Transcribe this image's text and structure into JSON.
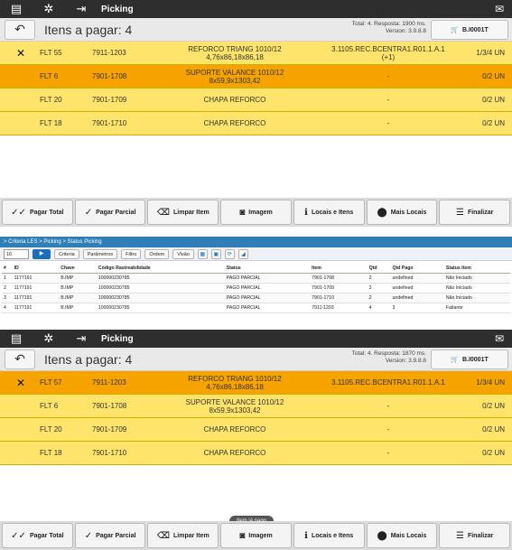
{
  "screens": [
    {
      "appbar": {
        "title": "Picking"
      },
      "header": {
        "itens_label": "Itens a pagar: 4",
        "total_line1": "Total: 4. Resposta: 1900 ms.",
        "total_line2": "Version: 3.9.8.8",
        "cart_label": "B.I0001T"
      },
      "rows": [
        {
          "flt": "FLT 55",
          "code": "7911-1203",
          "desc1": "REFORCO TRIANG 1010/12",
          "desc2": "4,76x86,18x86,18",
          "loc1": "3.1105.REC.BCENTRA1.R01.1.A.1",
          "loc2": "(+1)",
          "qty": "1/3/4 UN",
          "x": "✕"
        },
        {
          "flt": "FLT 6",
          "code": "7901-1708",
          "desc1": "SUPORTE VALANCE 1010/12",
          "desc2": "8x59,9x1303,42",
          "loc1": "-",
          "loc2": "",
          "qty": "0/2 UN"
        },
        {
          "flt": "FLT 20",
          "code": "7901-1709",
          "desc1": "CHAPA REFORCO",
          "desc2": "",
          "loc1": "-",
          "loc2": "",
          "qty": "0/2 UN"
        },
        {
          "flt": "FLT 18",
          "code": "7901-1710",
          "desc1": "CHAPA REFORCO",
          "desc2": "",
          "loc1": "-",
          "loc2": "",
          "qty": "0/2 UN"
        }
      ]
    },
    {
      "appbar": {
        "title": "Picking"
      },
      "header": {
        "itens_label": "Itens a pagar: 4",
        "total_line1": "Total: 4. Resposta: 1870 ms.",
        "total_line2": "Version: 3.9.8.8",
        "cart_label": "B.I0001T"
      },
      "rows": [
        {
          "flt": "FLT 57",
          "code": "7911-1203",
          "desc1": "REFORCO TRIANG 1010/12",
          "desc2": "4,76x86,18x86,18",
          "loc1": "3.1105.REC.BCENTRA1.R01.1.A.1",
          "loc2": "",
          "qty": "1/3/4 UN",
          "x": "✕"
        },
        {
          "flt": "FLT 6",
          "code": "7901-1708",
          "desc1": "SUPORTE VALANCE 1010/12",
          "desc2": "8x59,9x1303,42",
          "loc1": "-",
          "loc2": "",
          "qty": "0/2 UN"
        },
        {
          "flt": "FLT 20",
          "code": "7901-1709",
          "desc1": "CHAPA REFORCO",
          "desc2": "",
          "loc1": "-",
          "loc2": "",
          "qty": "0/2 UN"
        },
        {
          "flt": "FLT 18",
          "code": "7901-1710",
          "desc1": "CHAPA REFORCO",
          "desc2": "",
          "loc1": "-",
          "loc2": "",
          "qty": "0/2 UN"
        }
      ],
      "tooltip": "Item já pago"
    }
  ],
  "toolbar": {
    "pagar_total": "Pagar Total",
    "pagar_parcial": "Pagar Parcial",
    "limpar_item": "Limpar Item",
    "imagem": "Imagem",
    "locais_e_itens": "Locais e Itens",
    "mais_locais": "Mais Locais",
    "finalizar": "Finalizar"
  },
  "web": {
    "breadcrumb": "> Criteria LES > Picking > Status Picking",
    "page_size": "16",
    "buttons": {
      "criteria": "Criteria",
      "parametros": "Parâmetros",
      "filtro": "Filtro",
      "ordem": "Ordem",
      "visao": "Visão"
    },
    "columns": [
      "#",
      "ID",
      "Chave",
      "Código Rastreabilidade",
      "Status",
      "Item",
      "Qtd",
      "Qtd Pago",
      "Status Item"
    ],
    "rows": [
      [
        "1",
        "1177191",
        "B.IMP",
        "100000230785",
        "PAGO PARCIAL",
        "7901-1708",
        "2",
        "undefined",
        "Não Iniciado"
      ],
      [
        "2",
        "1177191",
        "B.IMP",
        "100000230785",
        "PAGO PARCIAL",
        "7901-1709",
        "2",
        "undefined",
        "Não Iniciado"
      ],
      [
        "3",
        "1177191",
        "B.IMP",
        "100000230785",
        "PAGO PARCIAL",
        "7901-1710",
        "2",
        "undefined",
        "Não Iniciado"
      ],
      [
        "4",
        "1177191",
        "B.IMP",
        "100000230785",
        "PAGO PARCIAL",
        "7911-1203",
        "4",
        "3",
        "Faltante"
      ]
    ]
  }
}
